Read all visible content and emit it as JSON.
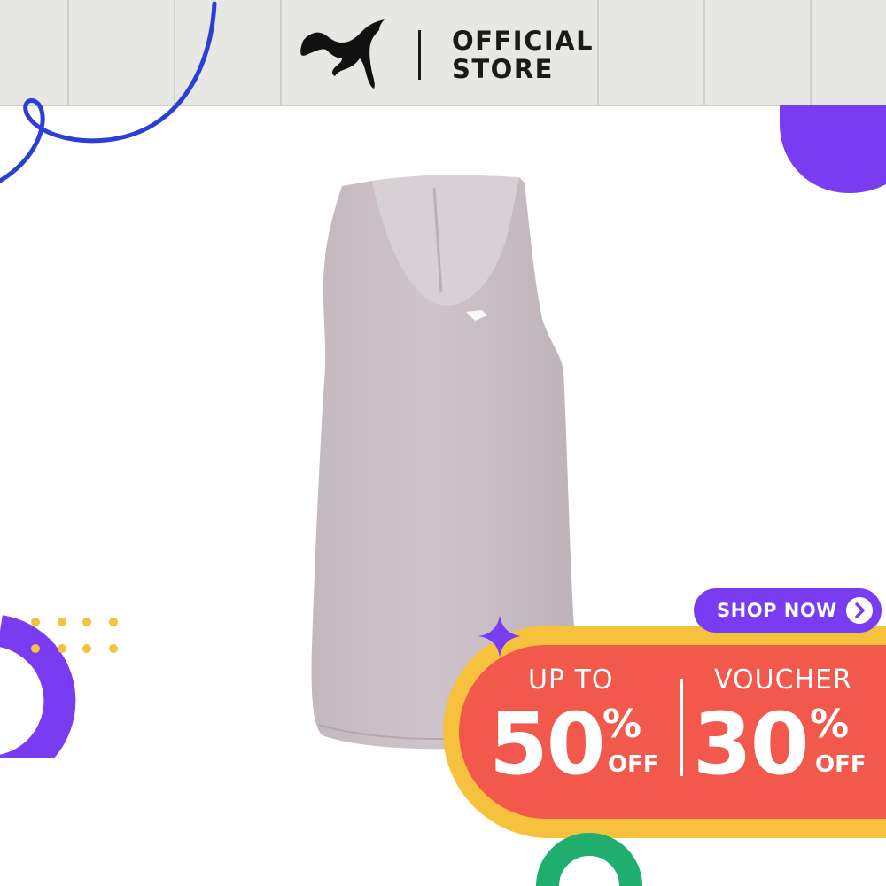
{
  "header": {
    "logo_icon": "puma-cat-icon",
    "store_line1": "OFFICIAL",
    "store_line2": "STORE"
  },
  "product": {
    "image": "womens-tank-top",
    "color": "#cbbfc6"
  },
  "cta": {
    "label": "SHOP NOW",
    "icon": "chevron-right-icon"
  },
  "promo": {
    "left": {
      "top_text": "UP TO",
      "number": "50",
      "percent": "%",
      "off": "OFF"
    },
    "right": {
      "top_text": "VOUCHER",
      "number": "30",
      "percent": "%",
      "off": "OFF"
    }
  },
  "colors": {
    "header_bg": "#e7e7e3",
    "accent_purple": "#7a3cf0",
    "accent_blue": "#2a3fd6",
    "accent_yellow": "#f6c23e",
    "accent_red": "#f2584c",
    "accent_green": "#1fae6e"
  }
}
